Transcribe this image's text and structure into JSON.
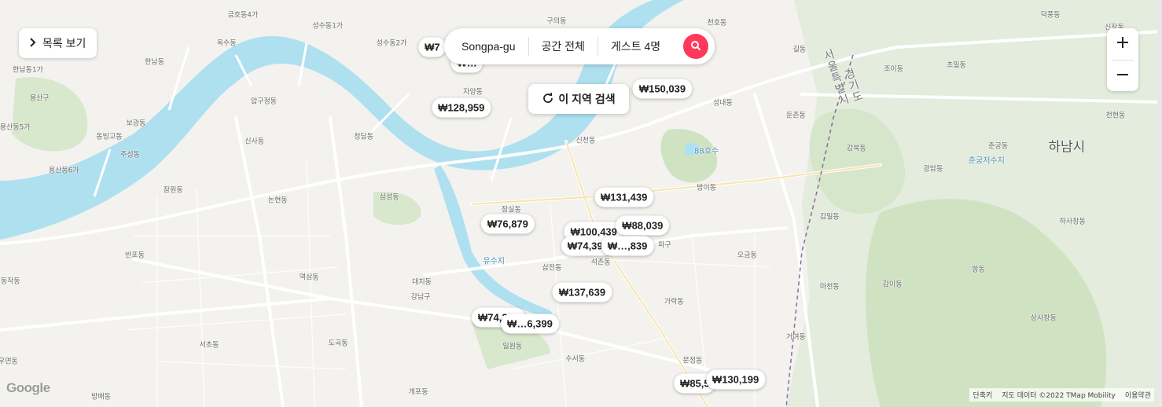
{
  "controls": {
    "list_button": "목록 보기",
    "search_location": "Songpa-gu",
    "search_space": "공간 전체",
    "search_guests": "게스트 4명",
    "area_search": "이 지역 검색"
  },
  "prices": [
    {
      "label": "₩7",
      "lon": 0.372,
      "lat": 0.116
    },
    {
      "label": "₩…",
      "lon": 0.402,
      "lat": 0.155
    },
    {
      "label": "₩128,959",
      "lon": 0.397,
      "lat": 0.264
    },
    {
      "label": "₩150,039",
      "lon": 0.57,
      "lat": 0.219
    },
    {
      "label": "₩131,439",
      "lon": 0.537,
      "lat": 0.484
    },
    {
      "label": "₩76,879",
      "lon": 0.437,
      "lat": 0.55
    },
    {
      "label": "₩100,439",
      "lon": 0.511,
      "lat": 0.57
    },
    {
      "label": "₩88,039",
      "lon": 0.553,
      "lat": 0.555
    },
    {
      "label": "₩74,399",
      "lon": 0.506,
      "lat": 0.604
    },
    {
      "label": "₩…,839",
      "lon": 0.54,
      "lat": 0.604
    },
    {
      "label": "₩137,639",
      "lon": 0.501,
      "lat": 0.719
    },
    {
      "label": "₩74,399",
      "lon": 0.429,
      "lat": 0.779
    },
    {
      "label": "₩…6,399",
      "lon": 0.456,
      "lat": 0.795
    },
    {
      "label": "₩85,5",
      "lon": 0.598,
      "lat": 0.942
    },
    {
      "label": "₩130,199",
      "lon": 0.633,
      "lat": 0.932
    }
  ],
  "labels": [
    {
      "text": "금호동4가",
      "lon": 0.209,
      "lat": 0.035,
      "kind": "area"
    },
    {
      "text": "성수동1가",
      "lon": 0.282,
      "lat": 0.062,
      "kind": "area"
    },
    {
      "text": "성수동2가",
      "lon": 0.337,
      "lat": 0.104,
      "kind": "area"
    },
    {
      "text": "구의동",
      "lon": 0.479,
      "lat": 0.05,
      "kind": "area"
    },
    {
      "text": "천호동",
      "lon": 0.617,
      "lat": 0.054,
      "kind": "area"
    },
    {
      "text": "덕풍동",
      "lon": 0.904,
      "lat": 0.035,
      "kind": "area"
    },
    {
      "text": "신장동",
      "lon": 0.959,
      "lat": 0.066,
      "kind": "area"
    },
    {
      "text": "옥수동",
      "lon": 0.195,
      "lat": 0.104,
      "kind": "area"
    },
    {
      "text": "한남동",
      "lon": 0.133,
      "lat": 0.151,
      "kind": "area"
    },
    {
      "text": "한남동1가",
      "lon": 0.024,
      "lat": 0.17,
      "kind": "area"
    },
    {
      "text": "용산구",
      "lon": 0.034,
      "lat": 0.239,
      "kind": "area"
    },
    {
      "text": "자양동",
      "lon": 0.407,
      "lat": 0.224,
      "kind": "area"
    },
    {
      "text": "압구정동",
      "lon": 0.227,
      "lat": 0.247,
      "kind": "area"
    },
    {
      "text": "성내동",
      "lon": 0.622,
      "lat": 0.251,
      "kind": "area"
    },
    {
      "text": "길동",
      "lon": 0.688,
      "lat": 0.12,
      "kind": "area"
    },
    {
      "text": "조이동",
      "lon": 0.769,
      "lat": 0.168,
      "kind": "area"
    },
    {
      "text": "초일동",
      "lon": 0.823,
      "lat": 0.158,
      "kind": "area"
    },
    {
      "text": "둔촌동",
      "lon": 0.685,
      "lat": 0.282,
      "kind": "area"
    },
    {
      "text": "천현동",
      "lon": 0.96,
      "lat": 0.282,
      "kind": "area"
    },
    {
      "text": "보광동",
      "lon": 0.117,
      "lat": 0.302,
      "kind": "area"
    },
    {
      "text": "용산동5가",
      "lon": 0.013,
      "lat": 0.311,
      "kind": "area"
    },
    {
      "text": "동빙고동",
      "lon": 0.094,
      "lat": 0.334,
      "kind": "area"
    },
    {
      "text": "신사동",
      "lon": 0.219,
      "lat": 0.346,
      "kind": "area"
    },
    {
      "text": "청담동",
      "lon": 0.313,
      "lat": 0.334,
      "kind": "area"
    },
    {
      "text": "신천동",
      "lon": 0.504,
      "lat": 0.344,
      "kind": "area"
    },
    {
      "text": "88호수",
      "lon": 0.608,
      "lat": 0.369,
      "kind": "water"
    },
    {
      "text": "감북동",
      "lon": 0.737,
      "lat": 0.363,
      "kind": "area"
    },
    {
      "text": "춘궁동",
      "lon": 0.859,
      "lat": 0.357,
      "kind": "area"
    },
    {
      "text": "하남시",
      "lon": 0.918,
      "lat": 0.357,
      "kind": "big"
    },
    {
      "text": "주성동",
      "lon": 0.112,
      "lat": 0.378,
      "kind": "area"
    },
    {
      "text": "광암동",
      "lon": 0.803,
      "lat": 0.413,
      "kind": "area"
    },
    {
      "text": "춘궁저수지",
      "lon": 0.849,
      "lat": 0.392,
      "kind": "water"
    },
    {
      "text": "용산동6가",
      "lon": 0.055,
      "lat": 0.417,
      "kind": "area"
    },
    {
      "text": "잠원동",
      "lon": 0.149,
      "lat": 0.465,
      "kind": "area"
    },
    {
      "text": "논현동",
      "lon": 0.239,
      "lat": 0.49,
      "kind": "area"
    },
    {
      "text": "삼성동",
      "lon": 0.335,
      "lat": 0.482,
      "kind": "area"
    },
    {
      "text": "방이동",
      "lon": 0.608,
      "lat": 0.459,
      "kind": "area"
    },
    {
      "text": "잠실동",
      "lon": 0.44,
      "lat": 0.514,
      "kind": "area"
    },
    {
      "text": "감일동",
      "lon": 0.714,
      "lat": 0.53,
      "kind": "area"
    },
    {
      "text": "하사창동",
      "lon": 0.923,
      "lat": 0.542,
      "kind": "area"
    },
    {
      "text": "유수지",
      "lon": 0.425,
      "lat": 0.639,
      "kind": "water"
    },
    {
      "text": "반포동",
      "lon": 0.116,
      "lat": 0.625,
      "kind": "area"
    },
    {
      "text": "오금동",
      "lon": 0.643,
      "lat": 0.625,
      "kind": "area"
    },
    {
      "text": "삼전동",
      "lon": 0.475,
      "lat": 0.656,
      "kind": "area"
    },
    {
      "text": "석촌동",
      "lon": 0.517,
      "lat": 0.643,
      "kind": "area"
    },
    {
      "text": "파구",
      "lon": 0.572,
      "lat": 0.6,
      "kind": "area"
    },
    {
      "text": "역삼동",
      "lon": 0.266,
      "lat": 0.679,
      "kind": "area"
    },
    {
      "text": "대치동",
      "lon": 0.363,
      "lat": 0.691,
      "kind": "area"
    },
    {
      "text": "마천동",
      "lon": 0.714,
      "lat": 0.703,
      "kind": "area"
    },
    {
      "text": "감이동",
      "lon": 0.768,
      "lat": 0.697,
      "kind": "area"
    },
    {
      "text": "항동",
      "lon": 0.842,
      "lat": 0.66,
      "kind": "area"
    },
    {
      "text": "동작동",
      "lon": 0.009,
      "lat": 0.689,
      "kind": "area"
    },
    {
      "text": "강남구",
      "lon": 0.362,
      "lat": 0.728,
      "kind": "area"
    },
    {
      "text": "가락동",
      "lon": 0.58,
      "lat": 0.739,
      "kind": "area"
    },
    {
      "text": "상사창동",
      "lon": 0.898,
      "lat": 0.779,
      "kind": "area"
    },
    {
      "text": "서초동",
      "lon": 0.18,
      "lat": 0.846,
      "kind": "area"
    },
    {
      "text": "도곡동",
      "lon": 0.291,
      "lat": 0.842,
      "kind": "area"
    },
    {
      "text": "일원동",
      "lon": 0.441,
      "lat": 0.849,
      "kind": "area"
    },
    {
      "text": "거여동",
      "lon": 0.685,
      "lat": 0.826,
      "kind": "area"
    },
    {
      "text": "수서동",
      "lon": 0.495,
      "lat": 0.88,
      "kind": "area"
    },
    {
      "text": "문정동",
      "lon": 0.596,
      "lat": 0.884,
      "kind": "area"
    },
    {
      "text": "우면동",
      "lon": 0.007,
      "lat": 0.886,
      "kind": "area"
    },
    {
      "text": "개포동",
      "lon": 0.36,
      "lat": 0.961,
      "kind": "area"
    },
    {
      "text": "방배동",
      "lon": 0.087,
      "lat": 0.973,
      "kind": "area"
    },
    {
      "text": "서울특별시",
      "lon": 0.719,
      "lat": 0.191,
      "kind": "road"
    },
    {
      "text": "경기도",
      "lon": 0.734,
      "lat": 0.21,
      "kind": "road"
    }
  ],
  "icons": {
    "list": "chevron-right-icon",
    "search": "search-icon",
    "refresh": "refresh-icon",
    "zoom_in": "plus-icon",
    "zoom_out": "minus-icon"
  },
  "branding": {
    "google": "Google",
    "shortcuts": "단축키",
    "map_data": "지도 데이터 ©2022 TMap Mobility",
    "terms": "이용약관"
  },
  "colors": {
    "accent": "#ff385c",
    "water": "#aee0f0",
    "green": "#d4e8c7"
  }
}
